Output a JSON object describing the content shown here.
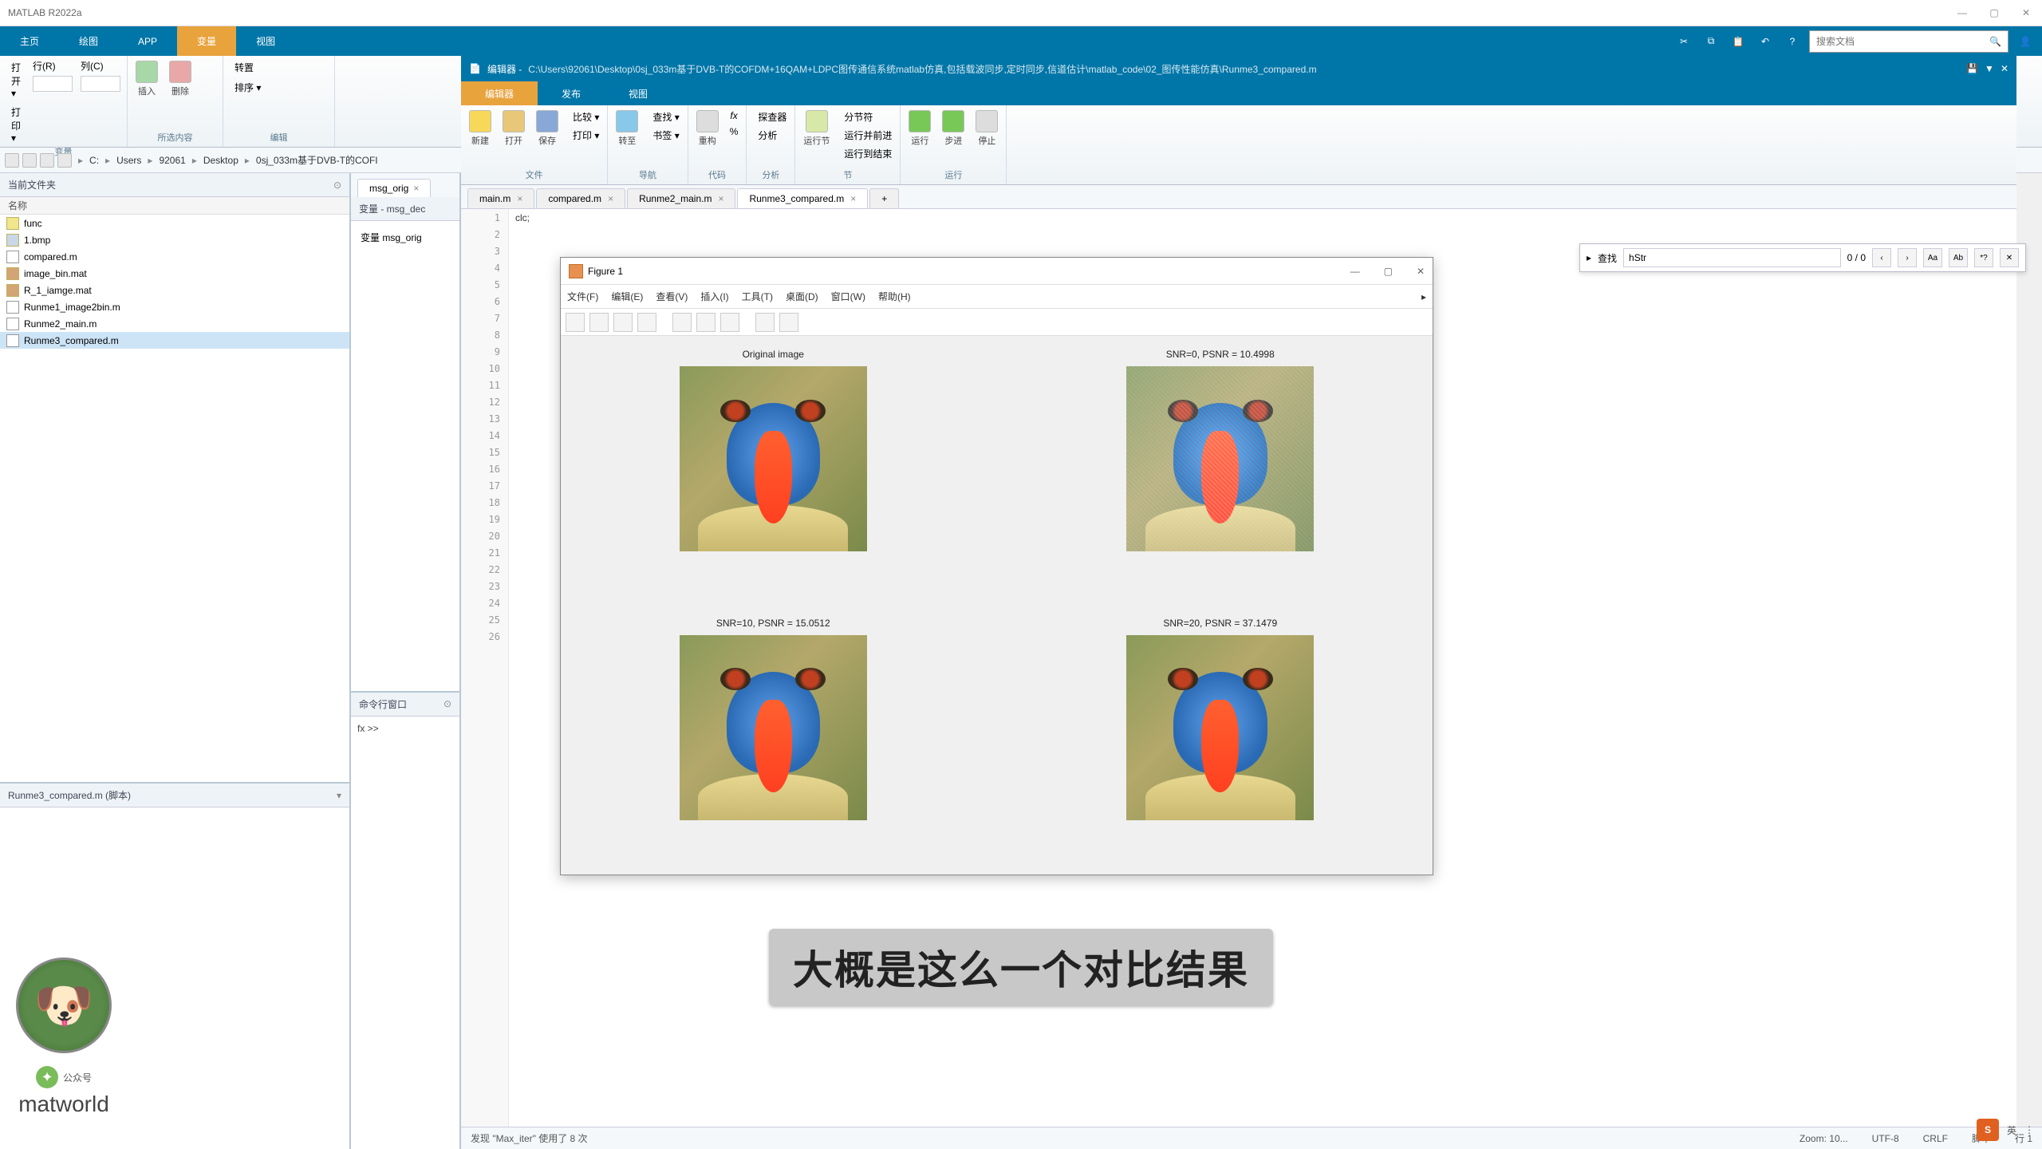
{
  "app": {
    "title": "MATLAB R2022a"
  },
  "mainTabs": {
    "home": "主页",
    "plot": "绘图",
    "apps": "APP",
    "variable": "变量",
    "view": "视图"
  },
  "searchDocs": {
    "placeholder": "搜索文档"
  },
  "varRibbon": {
    "openLabel": "打开 ▾",
    "row": "行(R)",
    "col": "列(C)",
    "printLabel": "打印 ▾",
    "insert": "插入",
    "delete": "删除",
    "sort": "排序 ▾",
    "transpose": "转置",
    "groupVar": "变量",
    "groupContent": "所选内容",
    "groupEdit": "编辑"
  },
  "address": {
    "label": "当前文件夹",
    "driveLbl": "C:",
    "p1": "Users",
    "p2": "92061",
    "p3": "Desktop",
    "p4": "0sj_033m基于DVB-T的COFI"
  },
  "currentFolder": {
    "header": "当前文件夹",
    "colName": "名称",
    "files": [
      {
        "name": "func",
        "type": "folder"
      },
      {
        "name": "1.bmp",
        "type": "bmp"
      },
      {
        "name": "compared.m",
        "type": "m"
      },
      {
        "name": "image_bin.mat",
        "type": "mat"
      },
      {
        "name": "R_1_iamge.mat",
        "type": "mat"
      },
      {
        "name": "Runme1_image2bin.m",
        "type": "m"
      },
      {
        "name": "Runme2_main.m",
        "type": "m"
      },
      {
        "name": "Runme3_compared.m",
        "type": "m",
        "selected": true
      }
    ]
  },
  "detail": {
    "title": "Runme3_compared.m (脚本)"
  },
  "varPanel": {
    "tab": "msg_orig",
    "header": "变量 - msg_dec",
    "text": "变量  msg_orig"
  },
  "cmd": {
    "title": "命令行窗口",
    "prompt": "fx >>"
  },
  "editor": {
    "titlePrefix": "编辑器 - ",
    "path": "C:\\Users\\92061\\Desktop\\0sj_033m基于DVB-T的COFDM+16QAM+LDPC图传通信系统matlab仿真,包括载波同步,定时同步,信道估计\\matlab_code\\02_图传性能仿真\\Runme3_compared.m",
    "tabsTop": {
      "editor": "编辑器",
      "publish": "发布",
      "view": "视图"
    },
    "ribbon": {
      "new": "新建",
      "open": "打开",
      "save": "保存",
      "compare": "比较 ▾",
      "print": "打印 ▾",
      "goto": "转至",
      "find": "查找 ▾",
      "bookmark": "书签 ▾",
      "refactor": "重构",
      "commentPct": "%",
      "analyze": "分析",
      "explorer": "探查器",
      "runSection": "运行节",
      "runAdvance": "运行并前进",
      "runToEnd": "运行到结束",
      "splitSection": "分节符",
      "run": "运行",
      "step": "步进",
      "stop": "停止",
      "gFile": "文件",
      "gNav": "导航",
      "gCode": "代码",
      "gAnalyze": "分析",
      "gSection": "节",
      "gRun": "运行"
    },
    "fileTabs": [
      {
        "name": "main.m"
      },
      {
        "name": "compared.m"
      },
      {
        "name": "Runme2_main.m"
      },
      {
        "name": "Runme3_compared.m",
        "active": true
      }
    ],
    "code": {
      "l1": "clc;"
    },
    "lineCount": 26
  },
  "find": {
    "label": "查找",
    "value": "hStr",
    "count": "0 / 0",
    "aa": "Aa",
    "ab": "Ab"
  },
  "figure": {
    "title": "Figure 1",
    "menu": {
      "file": "文件(F)",
      "edit": "编辑(E)",
      "view": "查看(V)",
      "insert": "插入(I)",
      "tools": "工具(T)",
      "desktop": "桌面(D)",
      "window": "窗口(W)",
      "help": "帮助(H)"
    },
    "subplots": [
      {
        "title": "Original image"
      },
      {
        "title": "SNR=0, PSNR = 10.4998"
      },
      {
        "title": "SNR=10, PSNR = 15.0512"
      },
      {
        "title": "SNR=20, PSNR = 37.1479"
      }
    ]
  },
  "status": {
    "found": "发现 \"Max_iter\" 使用了 8 次",
    "zoom": "Zoom: 10...",
    "enc": "UTF-8",
    "eol": "CRLF",
    "type": "脚本",
    "line": "行  1"
  },
  "subtitle": "大概是这么一个对比结果",
  "profile": {
    "pub": "公众号",
    "name": "matworld"
  },
  "ime": {
    "lang": "英",
    "s": "S"
  }
}
